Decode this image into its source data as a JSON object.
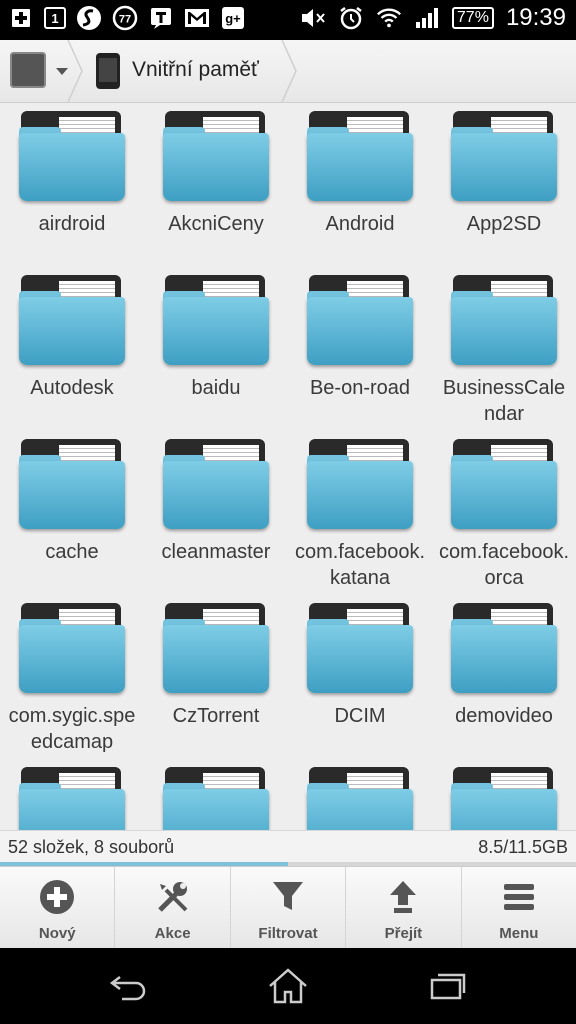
{
  "statusbar": {
    "notification_icons": [
      "plus-icon",
      "calendar-icon",
      "swiftkey-icon",
      "badge-77-icon",
      "text-message-icon",
      "gmail-icon",
      "google-plus-icon"
    ],
    "calendar_day": "1",
    "badge_number": "77",
    "battery": "77%",
    "time": "19:39"
  },
  "toolbar": {
    "location_label": "Vnitřní paměť"
  },
  "folders": [
    "airdroid",
    "AkcniCeny",
    "Android",
    "App2SD",
    "Autodesk",
    "baidu",
    "Be-on-road",
    "BusinessCalendar",
    "cache",
    "cleanmaster",
    "com.facebook.katana",
    "com.facebook.orca",
    "com.sygic.speedcamap",
    "CzTorrent",
    "DCIM",
    "demovideo",
    "",
    "",
    "",
    ""
  ],
  "status": {
    "summary": "52 složek, 8 souborů",
    "storage": "8.5/11.5GB",
    "progress_fraction": 0.5
  },
  "bottombar": {
    "new_label": "Nový",
    "actions_label": "Akce",
    "filter_label": "Filtrovat",
    "goto_label": "Přejít",
    "menu_label": "Menu"
  },
  "colors": {
    "folder_blue": "#4aa9cc",
    "accent": "#7fc0db"
  }
}
